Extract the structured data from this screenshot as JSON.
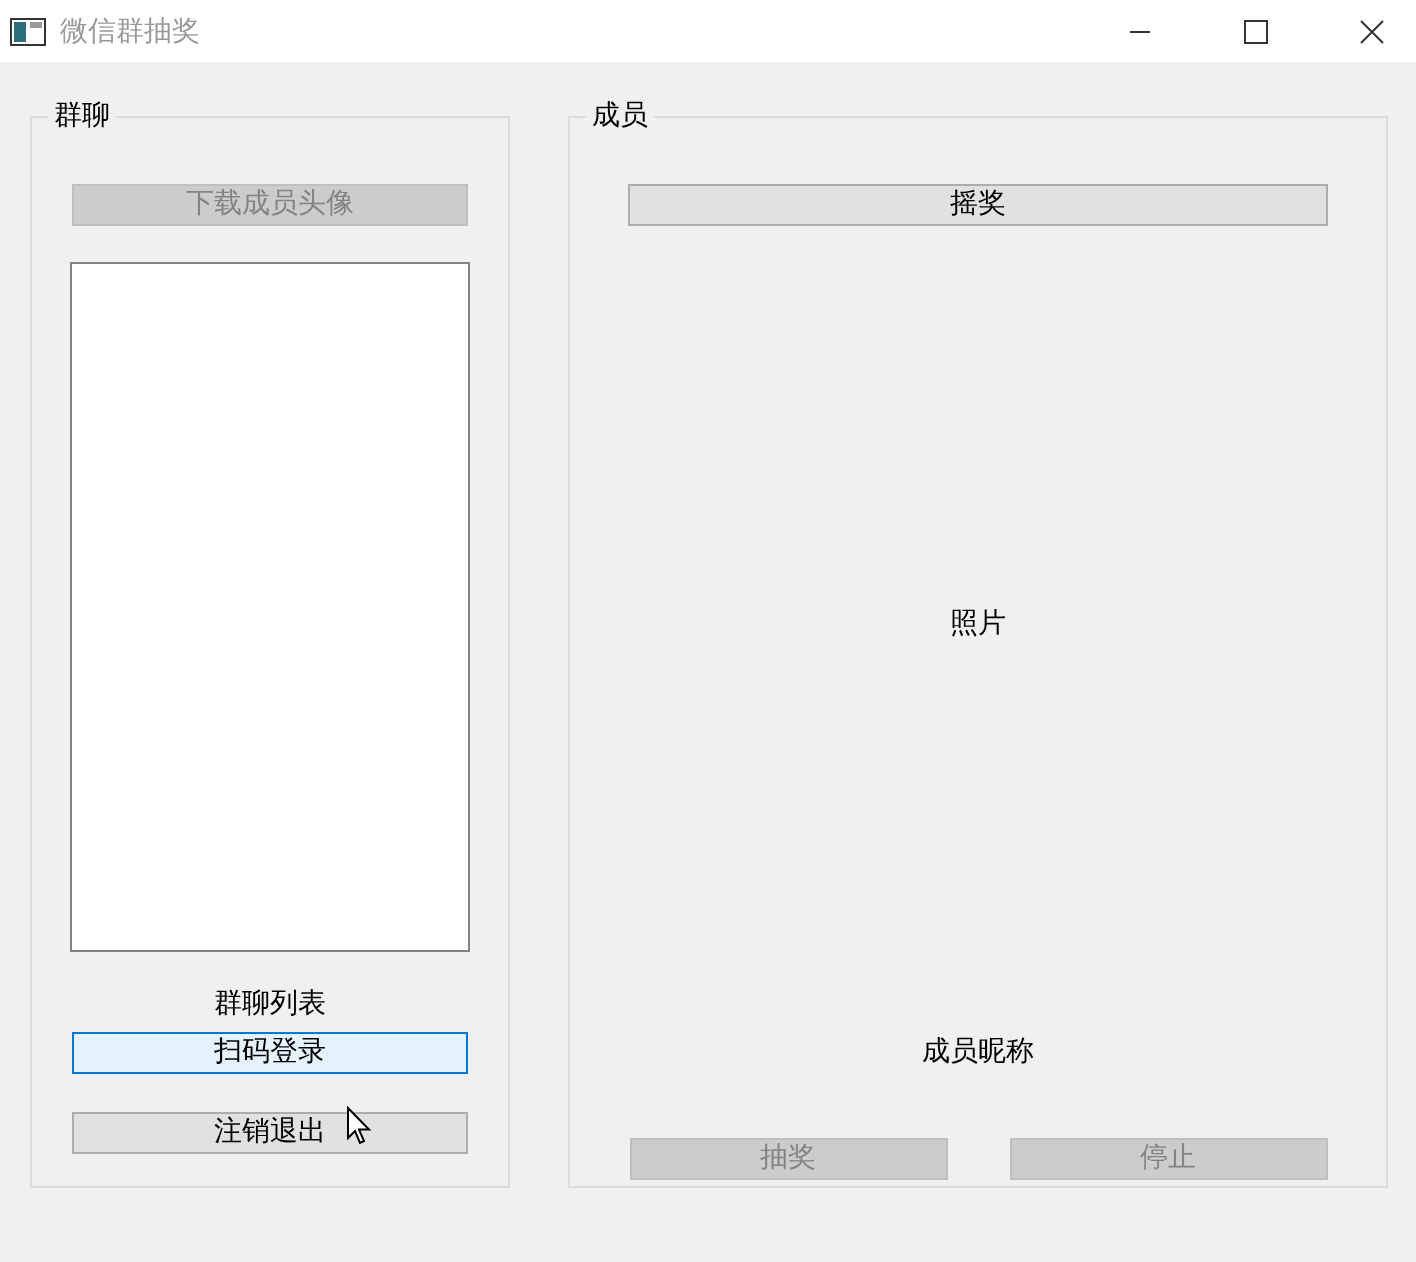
{
  "window": {
    "title": "微信群抽奖",
    "active": false
  },
  "group_chat": {
    "title": "群聊",
    "download_button": {
      "label": "下载成员头像",
      "disabled": true
    },
    "list_label": "群聊列表",
    "buttons": [
      {
        "label": "扫码登录",
        "disabled": false,
        "hovered": true
      },
      {
        "label": "注销退出",
        "disabled": false,
        "hovered": false
      }
    ]
  },
  "members": {
    "title": "成员",
    "shake_button": {
      "label": "摇奖",
      "disabled": false
    },
    "photo_label": "照片",
    "nickname_label": "成员昵称",
    "buttons": [
      {
        "label": "抽奖",
        "disabled": true
      },
      {
        "label": "停止",
        "disabled": true
      }
    ]
  }
}
